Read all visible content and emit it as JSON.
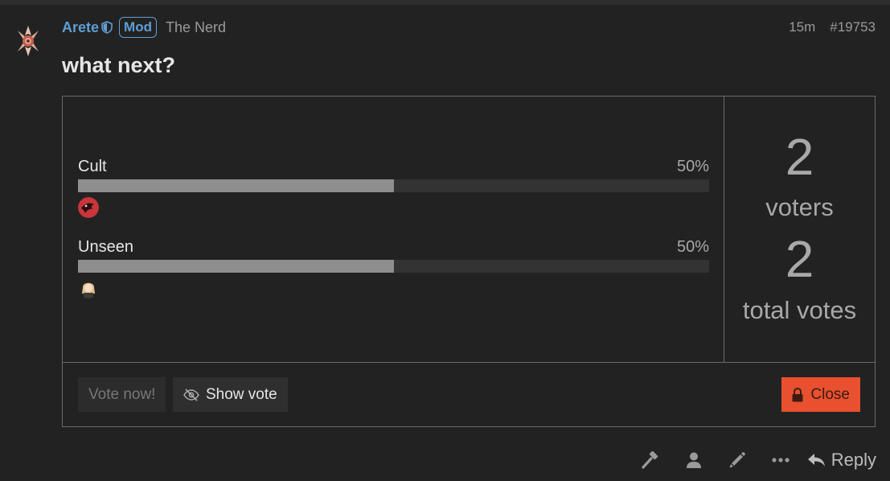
{
  "post": {
    "username": "Arete",
    "badge": "Mod",
    "user_title": "The Nerd",
    "age": "15m",
    "post_number": "#19753",
    "title": "what next?"
  },
  "poll": {
    "options": [
      {
        "label": "Cult",
        "percent_text": "50%",
        "percent": 50
      },
      {
        "label": "Unseen",
        "percent_text": "50%",
        "percent": 50
      }
    ],
    "voters_count": "2",
    "voters_label": "voters",
    "total_votes_count": "2",
    "total_votes_label": "total votes",
    "vote_button": "Vote now!",
    "show_vote_button": "Show vote",
    "close_button": "Close"
  },
  "actions": {
    "reply_label": "Reply",
    "icons": [
      "hammer-icon",
      "user-icon",
      "pencil-icon",
      "more-icon",
      "reply-icon"
    ]
  },
  "colors": {
    "background": "#222222",
    "username": "#5e9fd6",
    "close_button": "#e9502f",
    "bar_fill": "#8e8e8e"
  }
}
